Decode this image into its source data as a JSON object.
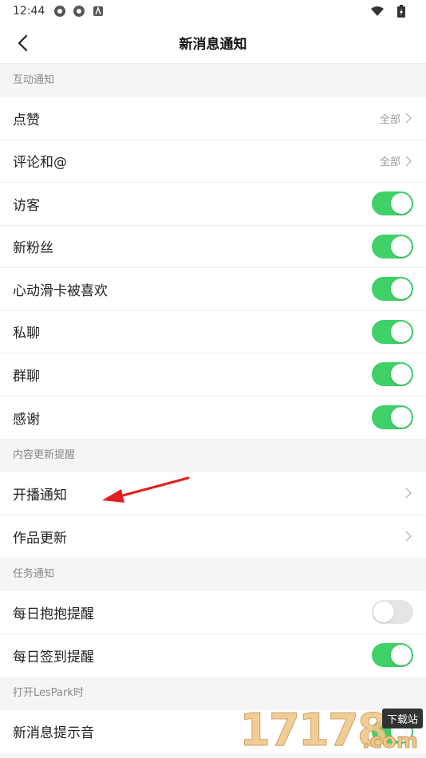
{
  "status_bar": {
    "time": "12:44"
  },
  "header": {
    "title": "新消息通知"
  },
  "sections": [
    {
      "title": "互动通知",
      "rows": [
        {
          "label": "点赞",
          "type": "link",
          "value": "全部"
        },
        {
          "label": "评论和@",
          "type": "link",
          "value": "全部"
        },
        {
          "label": "访客",
          "type": "toggle",
          "on": true
        },
        {
          "label": "新粉丝",
          "type": "toggle",
          "on": true
        },
        {
          "label": "心动滑卡被喜欢",
          "type": "toggle",
          "on": true
        },
        {
          "label": "私聊",
          "type": "toggle",
          "on": true
        },
        {
          "label": "群聊",
          "type": "toggle",
          "on": true
        },
        {
          "label": "感谢",
          "type": "toggle",
          "on": true
        }
      ]
    },
    {
      "title": "内容更新提醒",
      "rows": [
        {
          "label": "开播通知",
          "type": "link",
          "value": ""
        },
        {
          "label": "作品更新",
          "type": "link",
          "value": ""
        }
      ]
    },
    {
      "title": "任务通知",
      "rows": [
        {
          "label": "每日抱抱提醒",
          "type": "toggle",
          "on": false
        },
        {
          "label": "每日签到提醒",
          "type": "toggle",
          "on": true
        }
      ]
    },
    {
      "title": "打开LesPark时",
      "rows": [
        {
          "label": "新消息提示音",
          "type": "toggle",
          "on": true
        }
      ]
    }
  ],
  "watermark": {
    "digits": "17178",
    "tag": "下载站",
    "suffix": ".com"
  },
  "colors": {
    "toggle_on": "#3fd167",
    "toggle_off": "#e5e5e5",
    "annotation_arrow": "#e02020"
  }
}
